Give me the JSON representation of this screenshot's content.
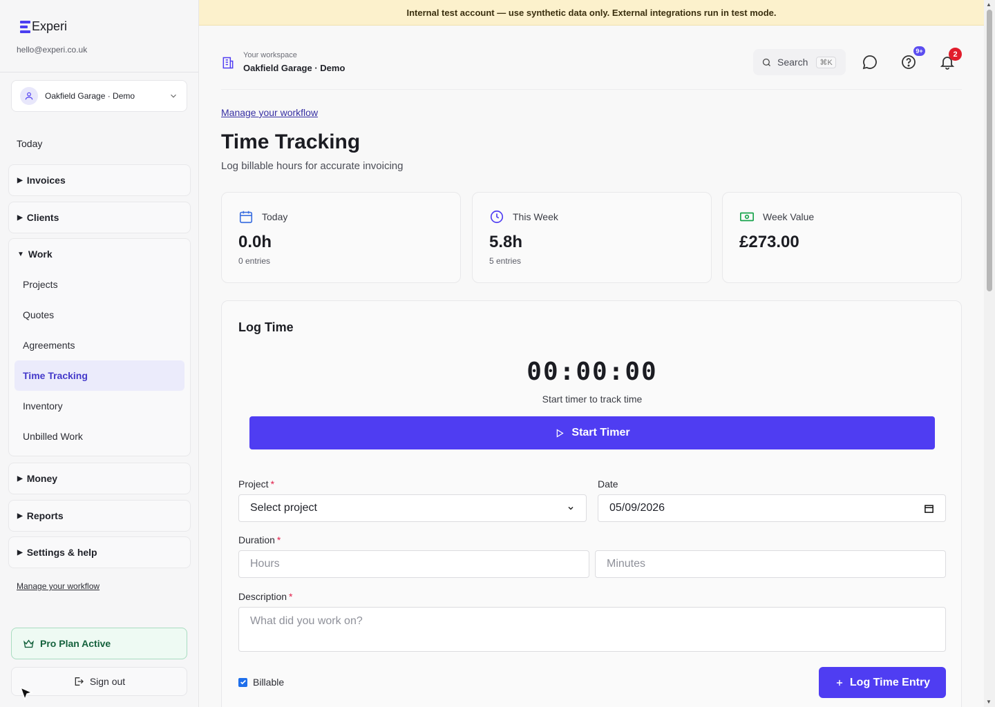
{
  "brand": {
    "name": "Experi",
    "email": "hello@experi.co.uk"
  },
  "workspace_selector": {
    "name": "Oakfield Garage · Demo"
  },
  "sidebar": {
    "today": "Today",
    "groups": {
      "invoices": "Invoices",
      "clients": "Clients",
      "work": "Work",
      "money": "Money",
      "reports": "Reports",
      "settings": "Settings & help"
    },
    "work_items": [
      "Projects",
      "Quotes",
      "Agreements",
      "Time Tracking",
      "Inventory",
      "Unbilled Work"
    ],
    "active_item": "Time Tracking",
    "manage_link": "Manage your workflow",
    "plan": "Pro Plan Active",
    "sign_out": "Sign out"
  },
  "banner": {
    "text": "Internal test account — use synthetic data only. External integrations run in test mode."
  },
  "topbar": {
    "workspace_label": "Your workspace",
    "workspace_name": "Oakfield Garage · Demo",
    "search_label": "Search",
    "search_shortcut": "⌘K",
    "help_badge": "9+",
    "notifications_badge": "2"
  },
  "page": {
    "manage_link": "Manage your workflow",
    "title": "Time Tracking",
    "subtitle": "Log billable hours for accurate invoicing"
  },
  "stats": [
    {
      "label": "Today",
      "value": "0.0h",
      "sub": "0 entries",
      "icon": "calendar-icon"
    },
    {
      "label": "This Week",
      "value": "5.8h",
      "sub": "5 entries",
      "icon": "clock-icon"
    },
    {
      "label": "Week Value",
      "value": "£273.00",
      "sub": "",
      "icon": "cash-icon"
    }
  ],
  "log_time": {
    "title": "Log Time",
    "timer": "00:00:00",
    "timer_hint": "Start timer to track time",
    "start_button": "Start Timer",
    "project_label": "Project",
    "project_value": "Select project",
    "date_label": "Date",
    "date_value": "05/09/2026",
    "duration_label": "Duration",
    "hours_placeholder": "Hours",
    "minutes_placeholder": "Minutes",
    "description_label": "Description",
    "description_placeholder": "What did you work on?",
    "billable_label": "Billable",
    "billable_checked": true,
    "submit_button": "Log Time Entry"
  },
  "colors": {
    "accent": "#4f3df2",
    "link": "#3730a3",
    "banner": "#fcf1cc",
    "pro": "#eefaf3"
  }
}
